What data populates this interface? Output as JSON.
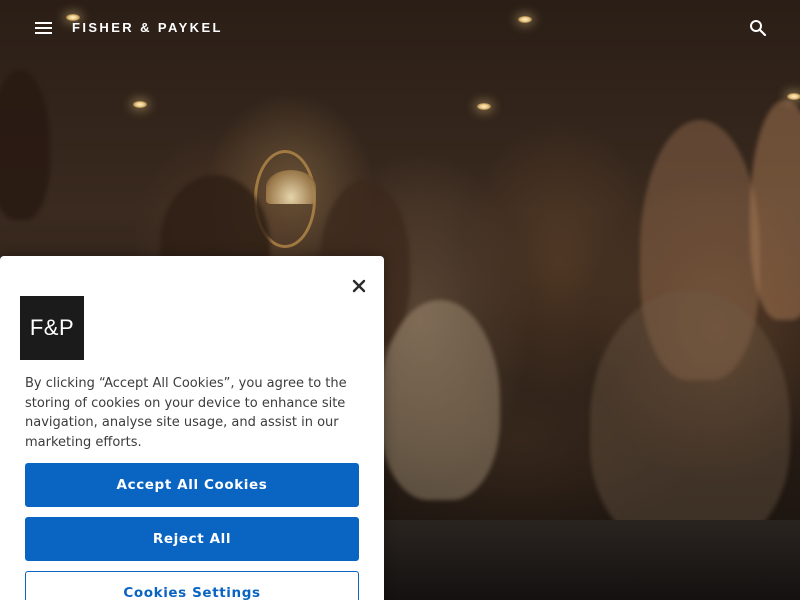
{
  "header": {
    "brand": "FISHER & PAYKEL",
    "menu_icon": "hamburger-menu-icon",
    "search_icon": "search-icon",
    "text_color": "#ffffff"
  },
  "hero": {
    "image": "people-socializing-in-kitchen-photo"
  },
  "cookie_banner": {
    "brand_badge": "F&P",
    "close_icon": "close-icon",
    "message": "By clicking “Accept All Cookies”, you agree to the storing of cookies on your device to enhance site navigation, analyse site usage, and assist in our marketing efforts.",
    "accept_label": "Accept All Cookies",
    "reject_label": "Reject All",
    "settings_label": "Cookies Settings",
    "accent_color": "#0a64c2"
  }
}
